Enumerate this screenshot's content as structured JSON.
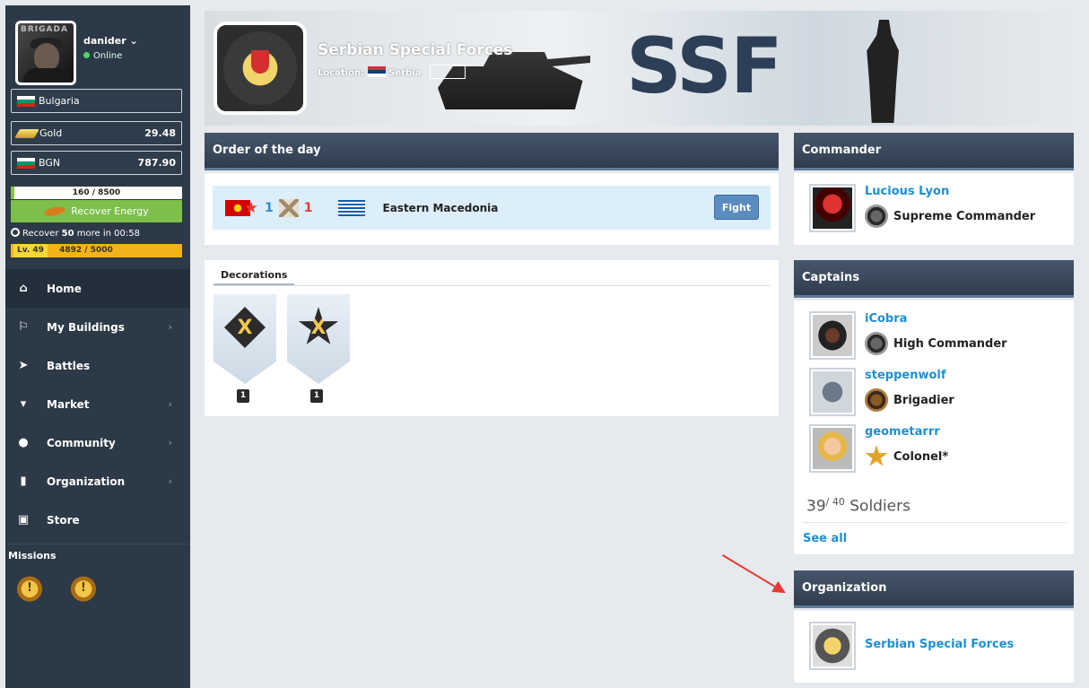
{
  "sidebar": {
    "username": "danider ⌄",
    "status": "Online",
    "avatar_tag": "BRIGADA",
    "country": "Bulgaria",
    "gold_label": "Gold",
    "gold_value": "29.48",
    "currency_label": "BGN",
    "currency_value": "787.90",
    "energy_text": "160 / 8500",
    "energy_fraction": 0.019,
    "recover_button": "Recover Energy",
    "recover_prefix": "Recover ",
    "recover_amount": "50",
    "recover_suffix": " more in 00:58",
    "level": "Lv. 49",
    "xp": "4892 / 5000",
    "xp_fraction": 0.978,
    "nav": [
      {
        "label": "Home",
        "icon": "home-icon"
      },
      {
        "label": "My Buildings",
        "icon": "flag-icon"
      },
      {
        "label": "Battles",
        "icon": "paper-plane-icon"
      },
      {
        "label": "Market",
        "icon": "cart-icon"
      },
      {
        "label": "Community",
        "icon": "users-icon"
      },
      {
        "label": "Organization",
        "icon": "building-icon"
      },
      {
        "label": "Store",
        "icon": "gift-icon"
      }
    ],
    "missions_title": "Missions"
  },
  "banner": {
    "org_name": "Serbian Special Forces",
    "location_label": "Location:",
    "location_country": "Serbia",
    "banner_text": "SSF"
  },
  "order_of_the_day": {
    "title": "Order of the day",
    "attacker_count": "1",
    "defender_count": "1",
    "region": "Eastern Macedonia",
    "fight_button": "Fight"
  },
  "decorations": {
    "tab": "Decorations",
    "items": [
      {
        "symbol": "X",
        "count": "1"
      },
      {
        "symbol": "X",
        "count": "1"
      }
    ]
  },
  "commander": {
    "title": "Commander",
    "name": "Lucious Lyon",
    "rank": "Supreme Commander"
  },
  "captains": {
    "title": "Captains",
    "list": [
      {
        "name": "iCobra",
        "rank": "High Commander"
      },
      {
        "name": "steppenwolf",
        "rank": "Brigadier"
      },
      {
        "name": "geometarrr",
        "rank": "Colonel*"
      }
    ],
    "soldiers_count": "39",
    "soldiers_max": "/ 40",
    "soldiers_label": "Soldiers",
    "see_all": "See all"
  },
  "organization": {
    "title": "Organization",
    "name": "Serbian Special Forces"
  },
  "colors": {
    "sidebar_bg": "#2c3947",
    "panel_header": "#3a4a5c",
    "link_blue": "#1e8fd4",
    "recover_green": "#7cc04b",
    "level_yellow": "#f2b31a",
    "annotation_arrow": "#e53935"
  }
}
